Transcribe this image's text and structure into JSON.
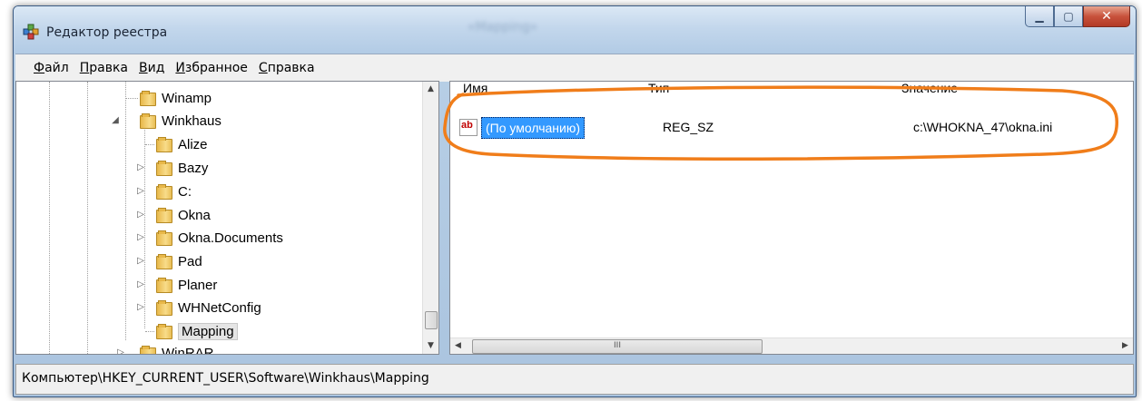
{
  "window": {
    "title": "Редактор реестра",
    "blurred_caption": "«Mapping»"
  },
  "menu": [
    {
      "label": "Файл",
      "u": "Ф",
      "rest": "айл"
    },
    {
      "label": "Правка",
      "u": "П",
      "rest": "равка"
    },
    {
      "label": "Вид",
      "u": "В",
      "rest": "ид"
    },
    {
      "label": "Избранное",
      "u": "И",
      "rest": "збранное"
    },
    {
      "label": "Справка",
      "u": "С",
      "rest": "правка"
    }
  ],
  "tree": {
    "items": [
      {
        "label": "Winamp"
      },
      {
        "label": "Winkhaus"
      },
      {
        "label": "Alize"
      },
      {
        "label": "Bazy"
      },
      {
        "label": "C:"
      },
      {
        "label": "Okna"
      },
      {
        "label": "Okna.Documents"
      },
      {
        "label": "Pad"
      },
      {
        "label": "Planer"
      },
      {
        "label": "WHNetConfig"
      },
      {
        "label": "Mapping"
      },
      {
        "label": "WinRAR"
      }
    ]
  },
  "list": {
    "columns": {
      "name": "Имя",
      "type": "Тип",
      "value": "Значение"
    },
    "rows": [
      {
        "icon": "ab",
        "name": "(По умолчанию)",
        "type": "REG_SZ",
        "value": "c:\\WHOKNA_47\\okna.ini"
      }
    ],
    "scroll_glyph": "III"
  },
  "status": {
    "path": "Компьютер\\HKEY_CURRENT_USER\\Software\\Winkhaus\\Mapping"
  },
  "colors": {
    "annotation": "#f07d1a",
    "selection": "#3399ff"
  }
}
